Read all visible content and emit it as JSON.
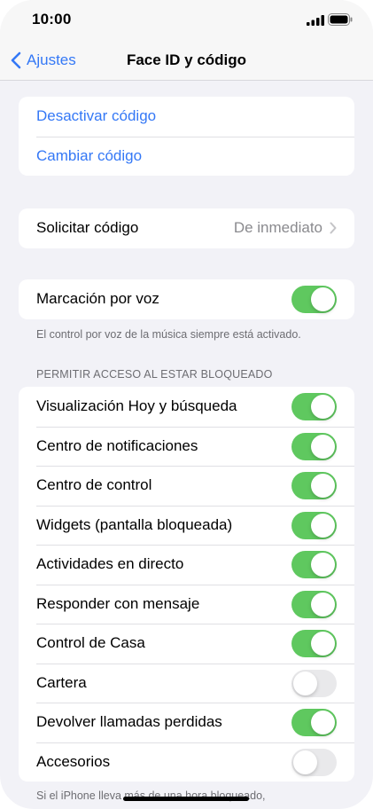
{
  "status_bar": {
    "time": "10:00"
  },
  "nav": {
    "back_label": "Ajustes",
    "title": "Face ID y código"
  },
  "code_group": {
    "turn_off": "Desactivar código",
    "change": "Cambiar código"
  },
  "require": {
    "label": "Solicitar código",
    "value": "De inmediato"
  },
  "voice": {
    "label": "Marcación por voz",
    "on": true,
    "footnote": "El control por voz de la música siempre está activado."
  },
  "locked_access": {
    "header": "PERMITIR ACCESO AL ESTAR BLOQUEADO",
    "items": [
      {
        "label": "Visualización Hoy y búsqueda",
        "on": true
      },
      {
        "label": "Centro de notificaciones",
        "on": true
      },
      {
        "label": "Centro de control",
        "on": true
      },
      {
        "label": "Widgets (pantalla bloqueada)",
        "on": true
      },
      {
        "label": "Actividades en directo",
        "on": true
      },
      {
        "label": "Responder con mensaje",
        "on": true
      },
      {
        "label": "Control de Casa",
        "on": true
      },
      {
        "label": "Cartera",
        "on": false
      },
      {
        "label": "Devolver llamadas perdidas",
        "on": true
      },
      {
        "label": "Accesorios",
        "on": false
      }
    ],
    "footnote": "Si el iPhone lleva más de una hora bloqueado,"
  },
  "colors": {
    "accent": "#3478f6",
    "toggle_on": "#5fc85f",
    "toggle_off": "#e9e9eb"
  }
}
